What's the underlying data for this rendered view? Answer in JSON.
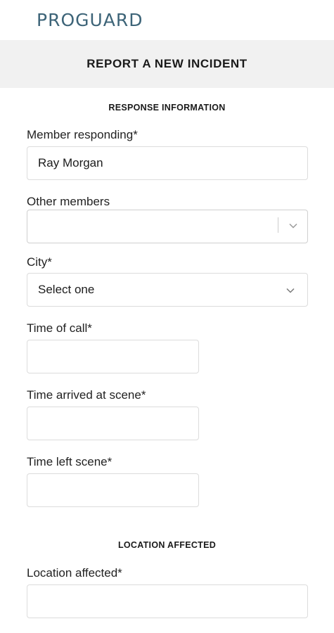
{
  "brand": {
    "logo_text": "PROGUARD"
  },
  "header": {
    "title": "REPORT A NEW INCIDENT"
  },
  "sections": {
    "response": {
      "heading": "RESPONSE INFORMATION"
    },
    "location": {
      "heading": "LOCATION AFFECTED"
    }
  },
  "form": {
    "member_responding": {
      "label": "Member responding*",
      "value": "Ray Morgan"
    },
    "other_members": {
      "label": "Other members",
      "value": ""
    },
    "city": {
      "label": "City*",
      "value": "Select one"
    },
    "time_of_call": {
      "label": "Time of call*",
      "value": ""
    },
    "time_arrived": {
      "label": "Time arrived at scene*",
      "value": ""
    },
    "time_left": {
      "label": "Time left scene*",
      "value": ""
    },
    "location_affected": {
      "label": "Location affected*",
      "value": ""
    }
  },
  "icons": {
    "dropdown": "chevron-down-icon"
  },
  "colors": {
    "brand": "#3d6478",
    "header_bg": "#f1f1f1",
    "field_border": "#dcdcdc"
  }
}
